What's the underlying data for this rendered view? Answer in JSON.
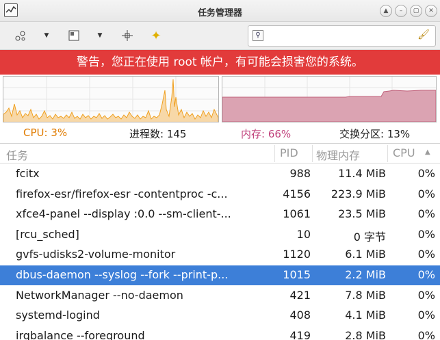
{
  "window": {
    "title": "任务管理器",
    "controls": [
      "▲",
      "–",
      "▢",
      "✕"
    ]
  },
  "search": {
    "value": "",
    "placeholder": ""
  },
  "warning": {
    "text": "警告，您正在使用 root 帐户，有可能会损害您的系统。",
    "background": "#e23b3b"
  },
  "stats": {
    "cpu": "CPU: 3%",
    "processes": "进程数: 145",
    "memory": "内存: 66%",
    "swap": "交换分区: 13%",
    "cpu_color": "#e07b00",
    "memory_color": "#c0407a"
  },
  "table": {
    "columns": [
      "任务",
      "PID",
      "物理内存",
      "CPU"
    ],
    "sort_column": "CPU",
    "rows": [
      {
        "task": "fcitx",
        "pid": "988",
        "mem": "11.4 MiB",
        "cpu": "0%"
      },
      {
        "task": "firefox-esr/firefox-esr -contentproc -c...",
        "pid": "4156",
        "mem": "223.9 MiB",
        "cpu": "0%"
      },
      {
        "task": "xfce4-panel --display :0.0 --sm-client-...",
        "pid": "1061",
        "mem": "23.5 MiB",
        "cpu": "0%"
      },
      {
        "task": "[rcu_sched]",
        "pid": "10",
        "mem": "0 字节",
        "cpu": "0%"
      },
      {
        "task": "gvfs-udisks2-volume-monitor",
        "pid": "1120",
        "mem": "6.1 MiB",
        "cpu": "0%"
      },
      {
        "task": "dbus-daemon --syslog --fork --print-p...",
        "pid": "1015",
        "mem": "2.2 MiB",
        "cpu": "0%"
      },
      {
        "task": "NetworkManager --no-daemon",
        "pid": "421",
        "mem": "7.8 MiB",
        "cpu": "0%"
      },
      {
        "task": "systemd-logind",
        "pid": "408",
        "mem": "4.1 MiB",
        "cpu": "0%"
      },
      {
        "task": "irqbalance --foreground",
        "pid": "419",
        "mem": "2.8 MiB",
        "cpu": "0%"
      }
    ],
    "selected_index": 5,
    "selection_color": "#3d7fd8"
  },
  "icons": {
    "toolbar": [
      "processes-icon",
      "dropdown-icon",
      "window-icon",
      "dropdown-icon",
      "crosshair-icon",
      "star-icon"
    ],
    "search": [
      "search-icon",
      "clear-brush-icon"
    ]
  },
  "graphs": {
    "cpu_color": "#f0a020",
    "memory_color": "#c0607a"
  }
}
